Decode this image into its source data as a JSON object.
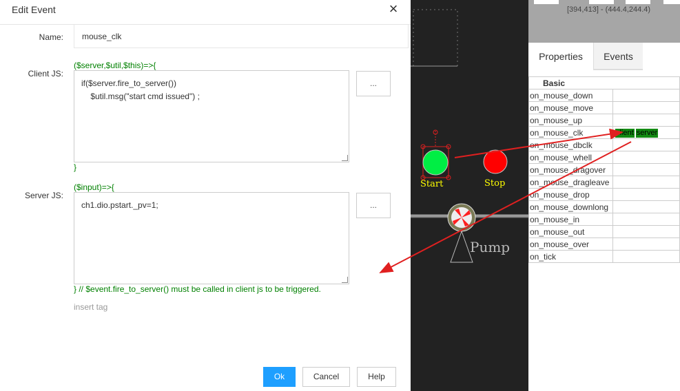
{
  "dialog": {
    "title": "Edit Event",
    "close_symbol": "×",
    "name_label": "Name:",
    "name_value": "mouse_clk",
    "client_label": "Client JS:",
    "client_sig": "($server,$util,$this)=>{",
    "client_code": "if($server.fire_to_server())\n    $util.msg(\"start cmd issued\") ;",
    "client_close": "}",
    "client_btn": "...",
    "server_label": "Server JS:",
    "server_sig": "($input)=>{",
    "server_code": "ch1.dio.pstart._pv=1;",
    "server_btn": "...",
    "server_note": "} // $event.fire_to_server() must be called in client js to be triggered.",
    "insert_tag": "insert tag",
    "ok": "Ok",
    "cancel": "Cancel",
    "help": "Help"
  },
  "canvas": {
    "start_label": "Start",
    "stop_label": "Stop",
    "pump_label": "Pump",
    "colors": {
      "start": "#00ee44",
      "stop": "#ff0000",
      "label": "#ffff00",
      "arrow": "#e02020"
    }
  },
  "panel": {
    "coords": "[394,413] - (444.4,244.4)",
    "tabs": [
      "Properties",
      "Events"
    ],
    "group": "Basic",
    "events": [
      "on_mouse_down",
      "on_mouse_move",
      "on_mouse_up",
      "on_mouse_clk",
      "on_mouse_dbclk",
      "on_mouse_whell",
      "on_mouse_dragover",
      "on_mouse_dragleave",
      "on_mouse_drop",
      "on_mouse_downlong",
      "on_mouse_in",
      "on_mouse_out",
      "on_mouse_over",
      "on_tick"
    ],
    "clk_badges": [
      "client",
      "server"
    ]
  }
}
